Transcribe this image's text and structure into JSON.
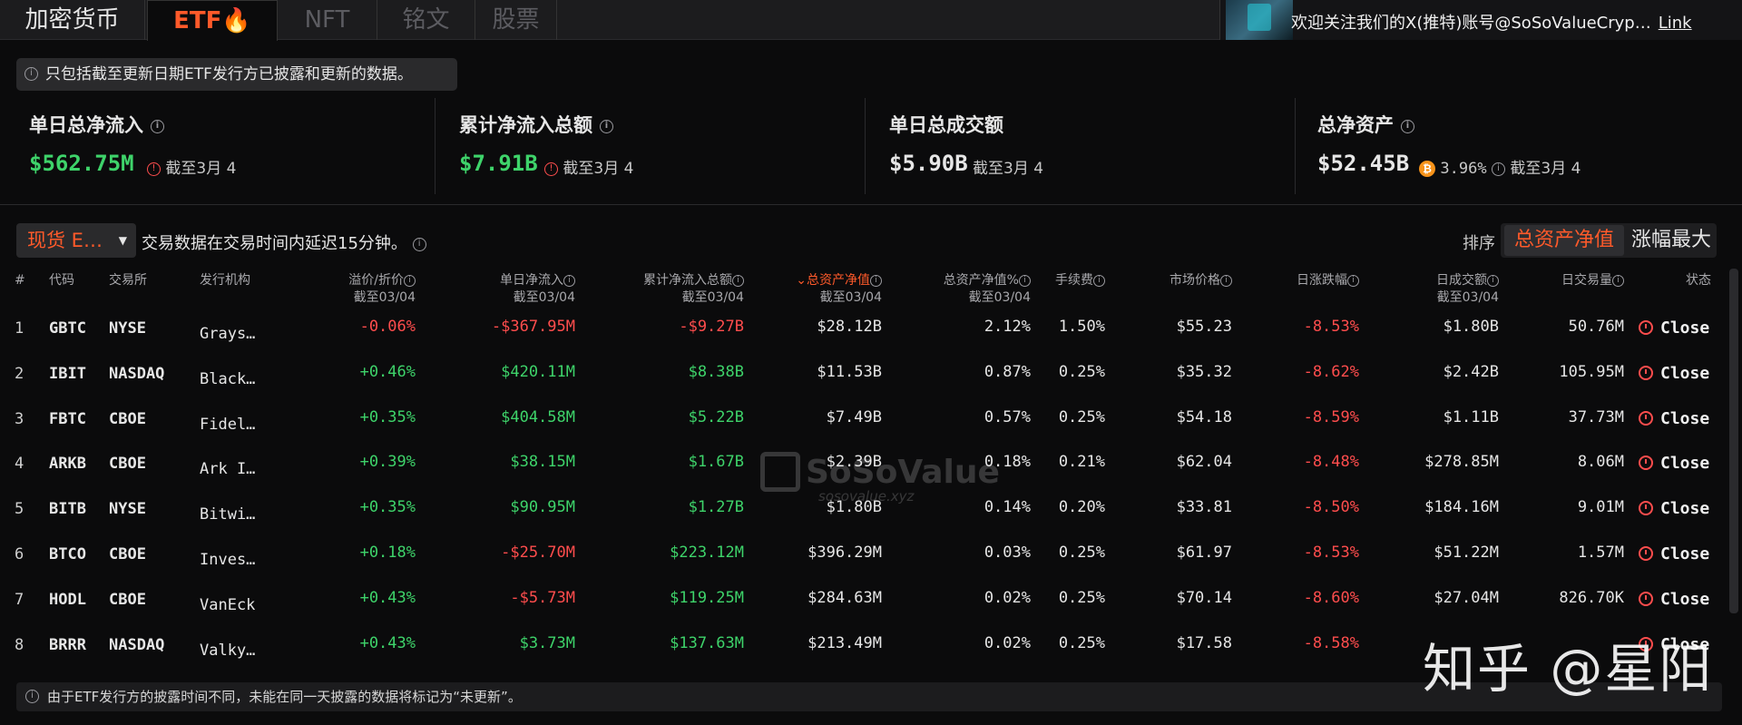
{
  "tabs": [
    {
      "label": "加密货币"
    },
    {
      "label": "ETF🔥"
    },
    {
      "label": "NFT"
    },
    {
      "label": "铭文"
    },
    {
      "label": "股票"
    }
  ],
  "banner": {
    "text": "欢迎关注我们的X(推特)账号@SoSoValueCryp…",
    "link": "Link"
  },
  "notice": "只包括截至更新日期ETF发行方已披露和更新的数据。",
  "stats": [
    {
      "title": "单日总净流入",
      "value": "$562.75M",
      "date": "截至3月 4",
      "value_color": "#3ed36a"
    },
    {
      "title": "累计净流入总额",
      "value": "$7.91B",
      "date": "截至3月 4",
      "value_color": "#3ed36a"
    },
    {
      "title": "单日总成交额",
      "value": "$5.90B",
      "date": "截至3月 4",
      "value_color": "#e6e6e6"
    },
    {
      "title": "总净资产",
      "value": "$52.45B",
      "btc_pct": "3.96%",
      "date": "截至3月 4",
      "value_color": "#e6e6e6"
    }
  ],
  "controls": {
    "type_select": "现货 E…",
    "delay_note": "交易数据在交易时间内延迟15分钟。",
    "sort_label": "排序",
    "sort_active": "总资产净值",
    "sort_other": "涨幅最大"
  },
  "table": {
    "headers": {
      "num": "#",
      "code": "代码",
      "exchange": "交易所",
      "issuer": "发行机构",
      "premium": "溢价/折价",
      "premium_sub": "截至03/04",
      "daily_flow": "单日净流入",
      "daily_flow_sub": "截至03/04",
      "cum_flow": "累计净流入总额",
      "cum_flow_sub": "截至03/04",
      "nav": "总资产净值",
      "nav_sub": "截至03/04",
      "nav_pct": "总资产净值%",
      "nav_pct_sub": "截至03/04",
      "fee": "手续费",
      "price": "市场价格",
      "change": "日涨跌幅",
      "value": "日成交额",
      "value_sub": "截至03/04",
      "volume": "日交易量",
      "status": "状态"
    },
    "rows": [
      {
        "num": "1",
        "code": "GBTC",
        "exchange": "NYSE",
        "issuer": "Grays…",
        "premium": "-0.06%",
        "daily_flow": "-$367.95M",
        "cum_flow": "-$9.27B",
        "nav": "$28.12B",
        "nav_pct": "2.12%",
        "fee": "1.50%",
        "price": "$55.23",
        "change": "-8.53%",
        "value": "$1.80B",
        "volume": "50.76M",
        "status": "Close"
      },
      {
        "num": "2",
        "code": "IBIT",
        "exchange": "NASDAQ",
        "issuer": "Black…",
        "premium": "+0.46%",
        "daily_flow": "$420.11M",
        "cum_flow": "$8.38B",
        "nav": "$11.53B",
        "nav_pct": "0.87%",
        "fee": "0.25%",
        "price": "$35.32",
        "change": "-8.62%",
        "value": "$2.42B",
        "volume": "105.95M",
        "status": "Close"
      },
      {
        "num": "3",
        "code": "FBTC",
        "exchange": "CBOE",
        "issuer": "Fidel…",
        "premium": "+0.35%",
        "daily_flow": "$404.58M",
        "cum_flow": "$5.22B",
        "nav": "$7.49B",
        "nav_pct": "0.57%",
        "fee": "0.25%",
        "price": "$54.18",
        "change": "-8.59%",
        "value": "$1.11B",
        "volume": "37.73M",
        "status": "Close"
      },
      {
        "num": "4",
        "code": "ARKB",
        "exchange": "CBOE",
        "issuer": "Ark I…",
        "premium": "+0.39%",
        "daily_flow": "$38.15M",
        "cum_flow": "$1.67B",
        "nav": "$2.39B",
        "nav_pct": "0.18%",
        "fee": "0.21%",
        "price": "$62.04",
        "change": "-8.48%",
        "value": "$278.85M",
        "volume": "8.06M",
        "status": "Close"
      },
      {
        "num": "5",
        "code": "BITB",
        "exchange": "NYSE",
        "issuer": "Bitwi…",
        "premium": "+0.35%",
        "daily_flow": "$90.95M",
        "cum_flow": "$1.27B",
        "nav": "$1.80B",
        "nav_pct": "0.14%",
        "fee": "0.20%",
        "price": "$33.81",
        "change": "-8.50%",
        "value": "$184.16M",
        "volume": "9.01M",
        "status": "Close"
      },
      {
        "num": "6",
        "code": "BTCO",
        "exchange": "CBOE",
        "issuer": "Inves…",
        "premium": "+0.18%",
        "daily_flow": "-$25.70M",
        "cum_flow": "$223.12M",
        "nav": "$396.29M",
        "nav_pct": "0.03%",
        "fee": "0.25%",
        "price": "$61.97",
        "change": "-8.53%",
        "value": "$51.22M",
        "volume": "1.57M",
        "status": "Close"
      },
      {
        "num": "7",
        "code": "HODL",
        "exchange": "CBOE",
        "issuer": "VanEck",
        "premium": "+0.43%",
        "daily_flow": "-$5.73M",
        "cum_flow": "$119.25M",
        "nav": "$284.63M",
        "nav_pct": "0.02%",
        "fee": "0.25%",
        "price": "$70.14",
        "change": "-8.60%",
        "value": "$27.04M",
        "volume": "826.70K",
        "status": "Close"
      },
      {
        "num": "8",
        "code": "BRRR",
        "exchange": "NASDAQ",
        "issuer": "Valky…",
        "premium": "+0.43%",
        "daily_flow": "$3.73M",
        "cum_flow": "$137.63M",
        "nav": "$213.49M",
        "nav_pct": "0.02%",
        "fee": "0.25%",
        "price": "$17.58",
        "change": "-8.58%",
        "value": "",
        "volume": "",
        "status": "Close"
      }
    ]
  },
  "footer": "由于ETF发行方的披露时间不同，未能在同一天披露的数据将标记为“未更新”。",
  "watermark": {
    "name": "SoSoValue",
    "site": "sosovalue.xyz"
  },
  "zhihu_watermark": "知乎 @星阳",
  "colors": {
    "accent": "#ff5a2a",
    "positive": "#3ed36a",
    "negative": "#ff4d4d",
    "background": "#0b0b0c"
  }
}
